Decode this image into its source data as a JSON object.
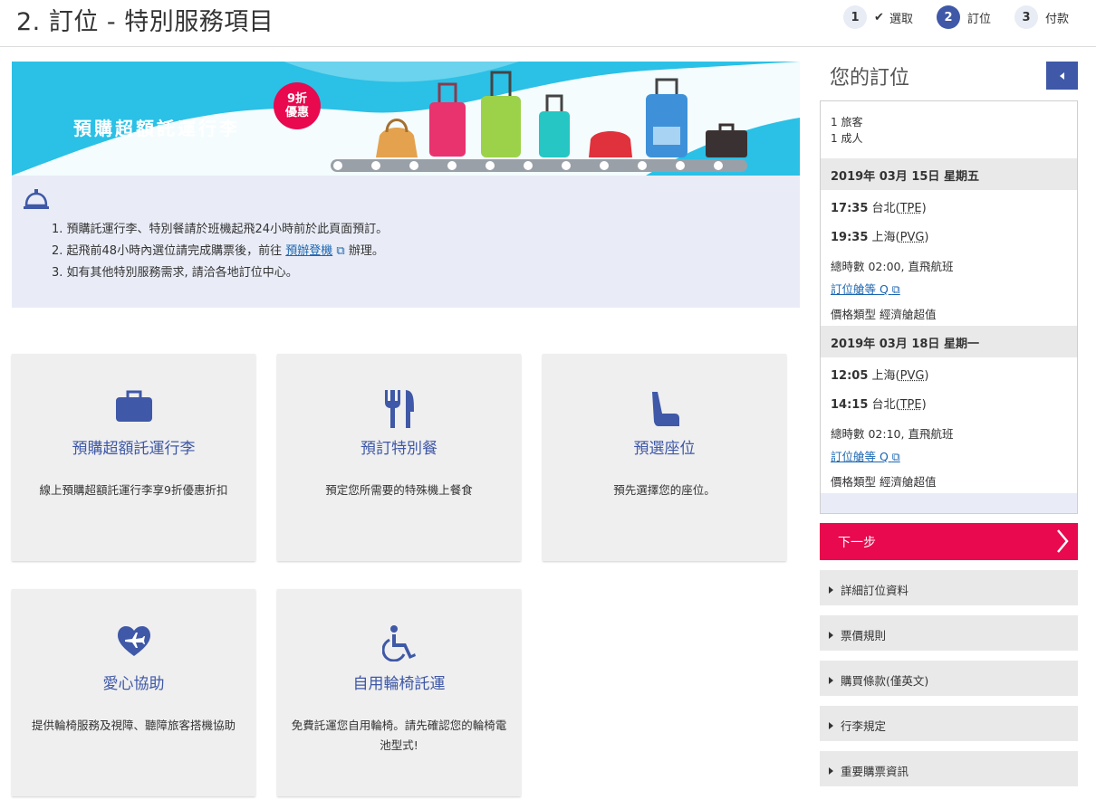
{
  "header": {
    "title": "2. 訂位 - 特別服務項目",
    "steps": [
      {
        "num": "1",
        "label": "選取",
        "done": true
      },
      {
        "num": "2",
        "label": "訂位",
        "active": true
      },
      {
        "num": "3",
        "label": "付款"
      }
    ]
  },
  "banner": {
    "text": "預購超額託運行李",
    "badge_line1": "9折",
    "badge_line2": "優惠"
  },
  "notice": {
    "item1": "1. 預購託運行李、特別餐請於班機起飛24小時前於此頁面預訂。",
    "item2_pre": "2. 起飛前48小時內選位請完成購票後，前往",
    "item2_link": "預辦登機",
    "item2_post": "辦理。",
    "item3": "3. 如有其他特別服務需求, 請洽各地訂位中心。"
  },
  "cards": [
    {
      "title": "預購超額託運行李",
      "desc": "線上預購超額託運行李享9折優惠折扣",
      "icon": "suitcase-icon"
    },
    {
      "title": "預訂特別餐",
      "desc": "預定您所需要的特殊機上餐食",
      "icon": "fork-knife-icon"
    },
    {
      "title": "預選座位",
      "desc": "預先選擇您的座位。",
      "icon": "seat-icon"
    },
    {
      "title": "愛心協助",
      "desc": "提供輪椅服務及視障、聽障旅客搭機協助",
      "icon": "heart-plane-icon"
    },
    {
      "title": "自用輪椅託運",
      "desc": "免費託運您自用輪椅。請先確認您的輪椅電池型式!",
      "icon": "wheelchair-icon"
    }
  ],
  "sidebar": {
    "title": "您的訂位",
    "pax_count": "1 旅客",
    "pax_type": "1 成人",
    "segments": [
      {
        "date": "2019年 03月 15日 星期五",
        "dep_time": "17:35",
        "dep_city": "台北(",
        "dep_code": "TPE",
        "arr_time": "19:35",
        "arr_city": "上海(",
        "arr_code": "PVG",
        "duration": "總時數 02:00, 直飛航班",
        "cabin": "訂位艙等 Q",
        "fare": "價格類型 經濟艙超值"
      },
      {
        "date": "2019年 03月 18日 星期一",
        "dep_time": "12:05",
        "dep_city": "上海(",
        "dep_code": "PVG",
        "arr_time": "14:15",
        "arr_city": "台北(",
        "arr_code": "TPE",
        "duration": "總時數 02:10, 直飛航班",
        "cabin": "訂位艙等 Q",
        "fare": "價格類型 經濟艙超值"
      }
    ],
    "next_label": "下一步",
    "accordions": [
      "詳細訂位資料",
      "票價規則",
      "購買條款(僅英文)",
      "行李規定",
      "重要購票資訊"
    ]
  },
  "colors": {
    "brand": "#3f58a7",
    "accent": "#e8094f",
    "link": "#1b66b1"
  }
}
